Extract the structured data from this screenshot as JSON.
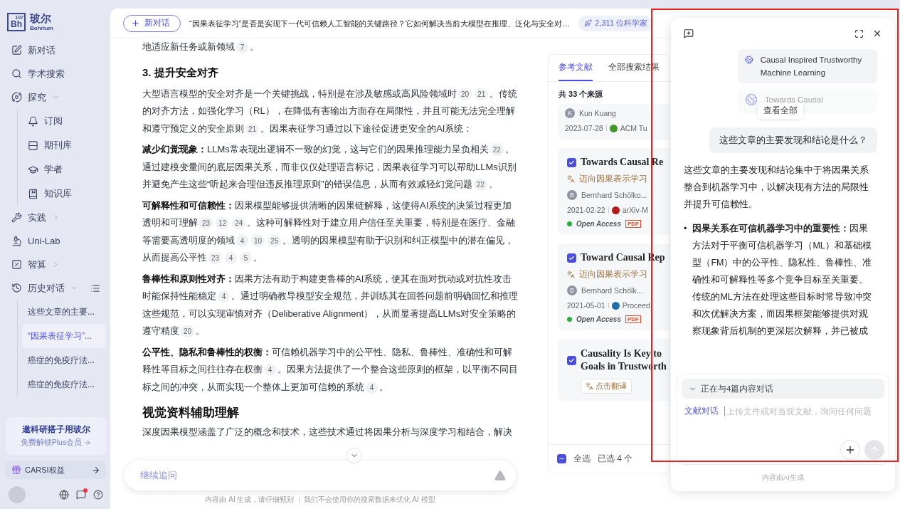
{
  "sidebar": {
    "logo": {
      "symbol": "Bh",
      "number": "107",
      "name": "玻尔",
      "subtitle": "Bohrium"
    },
    "items": [
      {
        "kind": "link",
        "label": "新对话"
      },
      {
        "kind": "link",
        "label": "学术搜索"
      },
      {
        "kind": "group",
        "label": "探究",
        "expanded": true,
        "children": [
          {
            "label": "订阅"
          },
          {
            "label": "期刊库"
          },
          {
            "label": "学者"
          },
          {
            "label": "知识库"
          }
        ]
      },
      {
        "kind": "group",
        "label": "实践",
        "expanded": false
      },
      {
        "kind": "link",
        "label": "Uni-Lab"
      },
      {
        "kind": "group",
        "label": "智算",
        "expanded": false
      },
      {
        "kind": "history",
        "label": "历史对话",
        "expanded": true,
        "children": [
          {
            "label": "这些文章的主要...",
            "selected": false
          },
          {
            "label": "“因果表征学习”...",
            "selected": true
          },
          {
            "label": "癌症的免疫疗法...",
            "selected": false
          },
          {
            "label": "癌症的免疫疗法...",
            "selected": false
          }
        ]
      }
    ],
    "promo": {
      "title": "邀科研搭子用玻尔",
      "subtitle": "免费解锁Plus会员"
    },
    "carsi": {
      "label": "CARSI权益"
    }
  },
  "topbar": {
    "new_chat": "新对话",
    "title": "“因果表征学习”是否是实现下一代可信赖人工智能的关键路径？它如何解决当前大模型在推理、泛化与安全对…",
    "chip": "2,311 位科学家"
  },
  "article": {
    "blocks": [
      {
        "kind": "para",
        "parts": [
          {
            "kind": "text",
            "text": "地适应新任务或新领域"
          },
          {
            "kind": "cite",
            "text": "7"
          },
          {
            "kind": "text",
            "text": "。"
          }
        ]
      },
      {
        "kind": "h3",
        "text": "3. 提升安全对齐"
      },
      {
        "kind": "para",
        "parts": [
          {
            "kind": "text",
            "text": "大型语言模型的安全对齐是一个关键挑战，特别是在涉及敏感或高风险领域时"
          },
          {
            "kind": "cite",
            "text": "20"
          },
          {
            "kind": "cite",
            "text": "21"
          },
          {
            "kind": "text",
            "text": "。传统的对齐方法，如强化学习（RL），在降低有害输出方面存在局限性，并且可能无法完全理解和遵守预定义的安全原则"
          },
          {
            "kind": "cite",
            "text": "21"
          },
          {
            "kind": "text",
            "text": "。因果表征学习通过以下途径促进更安全的AI系统："
          }
        ]
      },
      {
        "kind": "para",
        "lead": "减少幻觉现象：",
        "parts": [
          {
            "kind": "text",
            "text": "LLMs常表现出逻辑不一致的幻觉，这与它们的因果推理能力呈负相关"
          },
          {
            "kind": "cite",
            "text": "22"
          },
          {
            "kind": "text",
            "text": "。通过建模变量间的底层因果关系，而非仅仅处理语言标记，因果表征学习可以帮助LLMs识别并避免产生这些“听起来合理但违反推理原则”的错误信息，从而有效减轻幻觉问题"
          },
          {
            "kind": "cite",
            "text": "22"
          },
          {
            "kind": "text",
            "text": "。"
          }
        ]
      },
      {
        "kind": "para",
        "lead": "可解释性和可信赖性：",
        "parts": [
          {
            "kind": "text",
            "text": "因果模型能够提供清晰的因果链解释，这使得AI系统的决策过程更加透明和可理解"
          },
          {
            "kind": "cite",
            "text": "23"
          },
          {
            "kind": "cite",
            "text": "12"
          },
          {
            "kind": "cite",
            "text": "24"
          },
          {
            "kind": "text",
            "text": "。这种可解释性对于建立用户信任至关重要，特别是在医疗、金融等需要高透明度的领域"
          },
          {
            "kind": "cite",
            "text": "4"
          },
          {
            "kind": "cite",
            "text": "10"
          },
          {
            "kind": "cite",
            "text": "25"
          },
          {
            "kind": "text",
            "text": "。透明的因果模型有助于识别和纠正模型中的潜在偏见，从而提高公平性"
          },
          {
            "kind": "cite",
            "text": "23"
          },
          {
            "kind": "cite",
            "text": "4"
          },
          {
            "kind": "cite",
            "text": "5"
          },
          {
            "kind": "text",
            "text": "。"
          }
        ]
      },
      {
        "kind": "para",
        "lead": "鲁棒性和原则性对齐：",
        "parts": [
          {
            "kind": "text",
            "text": "因果方法有助于构建更鲁棒的AI系统，使其在面对扰动或对抗性攻击时能保持性能稳定"
          },
          {
            "kind": "cite",
            "text": "4"
          },
          {
            "kind": "text",
            "text": "。通过明确教导模型安全规范，并训练其在回答问题前明确回忆和推理这些规范，可以实现审慎对齐（Deliberative Alignment），从而显著提高LLMs对安全策略的遵守精度"
          },
          {
            "kind": "cite",
            "text": "20"
          },
          {
            "kind": "text",
            "text": "。"
          }
        ]
      },
      {
        "kind": "para",
        "lead": "公平性、隐私和鲁棒性的权衡：",
        "parts": [
          {
            "kind": "text",
            "text": "可信赖机器学习中的公平性、隐私、鲁棒性、准确性和可解释性等目标之间往往存在权衡"
          },
          {
            "kind": "cite",
            "text": "4"
          },
          {
            "kind": "text",
            "text": "。因果方法提供了一个整合这些原则的框架，以平衡不同目标之间的冲突，从而实现一个整体上更加可信赖的系统"
          },
          {
            "kind": "cite",
            "text": "4"
          },
          {
            "kind": "text",
            "text": "。"
          }
        ]
      },
      {
        "kind": "h2",
        "text": "视觉资料辅助理解"
      },
      {
        "kind": "para",
        "parts": [
          {
            "kind": "text",
            "text": "深度因果模型涵盖了广泛的概念和技术，这些技术通过将因果分析与深度学习相结合，解决"
          }
        ]
      }
    ],
    "followup": {
      "placeholder": "继续追问"
    },
    "disclaimer": [
      "内容由 AI 生成，请仔细甄别",
      "我们不会使用你的搜索数据来优化 AI 模型"
    ]
  },
  "references": {
    "tabs": [
      {
        "label": "参考文献",
        "selected": true
      },
      {
        "label": "全部搜索结果",
        "selected": false
      }
    ],
    "count": "共 33 个来源",
    "cards": [
      {
        "kind": "partial",
        "initial": "K",
        "author": "Kun Kuang",
        "date": "2023-07-28",
        "venue": "ACM Tu",
        "color": "#3f9a2a"
      },
      {
        "kind": "full",
        "checked": true,
        "title": "Towards Causal Re",
        "translation": "迈向因果表示学习",
        "initial": "B",
        "author": "Bernhard Schölko...",
        "date": "2021-02-22",
        "venue": "arXiv-M",
        "color": "#b31b1b",
        "access": "Open Access",
        "pdf": "PDF"
      },
      {
        "kind": "full",
        "checked": true,
        "title": "Toward Causal Rep",
        "translation": "迈向因果表示学习",
        "initial": "B",
        "author": "Bernhard Schölk...",
        "date": "2021-05-01",
        "venue": "Proceed",
        "color": "#1f6fa8",
        "access": "Open Access",
        "pdf": "PDF"
      },
      {
        "kind": "untranslated",
        "checked": true,
        "title_lines": [
          "Causality Is Key to",
          "Goals in Trustworth"
        ],
        "translate": "点击翻译"
      }
    ],
    "footer": {
      "select_all": "全选",
      "partially_selected": true,
      "selected_count": "已选 4 个"
    }
  },
  "chat": {
    "docs": [
      {
        "title": "Causal Inspired Trustworthy Machine Learning",
        "faded": false
      },
      {
        "title": "Towards Causal",
        "faded": true
      }
    ],
    "view_all": "查看全部",
    "question": "这些文章的主要发现和结论是什么？",
    "answer": "这些文章的主要发现和结论集中于将因果关系整合到机器学习中，以解决现有方法的局限性并提升可信赖性。",
    "bullets": [
      {
        "marker": "•",
        "lead": "因果关系在可信机器学习中的重要性：",
        "text": "因果方法对于平衡可信机器学习（ML）和基础模型（FM）中的公平性、隐私性、鲁棒性、准确性和可解释性等多个竞争目标至关重要。传统的ML方法在处理这些目标时常导致冲突和次优解决方案，而因果框架能够提供对观察现象背后机制的更深层次解释，并已被成"
      }
    ],
    "context": {
      "label": "正在与4篇内容对话",
      "expanded": false
    },
    "mode": "文献对话",
    "placeholder": "上传文件或对当前文献，询问任何问题",
    "footer": "内容由AI生成"
  }
}
